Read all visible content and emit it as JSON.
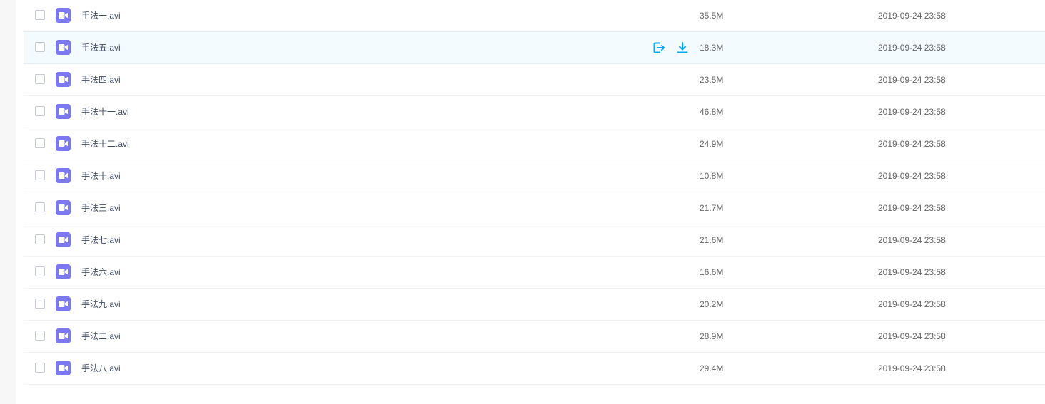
{
  "files": [
    {
      "name": "手法一.avi",
      "size": "35.5M",
      "date": "2019-09-24 23:58"
    },
    {
      "name": "手法五.avi",
      "size": "18.3M",
      "date": "2019-09-24 23:58"
    },
    {
      "name": "手法四.avi",
      "size": "23.5M",
      "date": "2019-09-24 23:58"
    },
    {
      "name": "手法十一.avi",
      "size": "46.8M",
      "date": "2019-09-24 23:58"
    },
    {
      "name": "手法十二.avi",
      "size": "24.9M",
      "date": "2019-09-24 23:58"
    },
    {
      "name": "手法十.avi",
      "size": "10.8M",
      "date": "2019-09-24 23:58"
    },
    {
      "name": "手法三.avi",
      "size": "21.7M",
      "date": "2019-09-24 23:58"
    },
    {
      "name": "手法七.avi",
      "size": "21.6M",
      "date": "2019-09-24 23:58"
    },
    {
      "name": "手法六.avi",
      "size": "16.6M",
      "date": "2019-09-24 23:58"
    },
    {
      "name": "手法九.avi",
      "size": "20.2M",
      "date": "2019-09-24 23:58"
    },
    {
      "name": "手法二.avi",
      "size": "28.9M",
      "date": "2019-09-24 23:58"
    },
    {
      "name": "手法八.avi",
      "size": "29.4M",
      "date": "2019-09-24 23:58"
    }
  ],
  "hover_row_index": 1,
  "hover_actions": [
    {
      "icon": "share-icon"
    },
    {
      "icon": "download-icon"
    }
  ],
  "colors": {
    "accent": "#06a7ff",
    "video_icon": "#7b78f2",
    "hover_row_bg": "#f4fbff"
  }
}
